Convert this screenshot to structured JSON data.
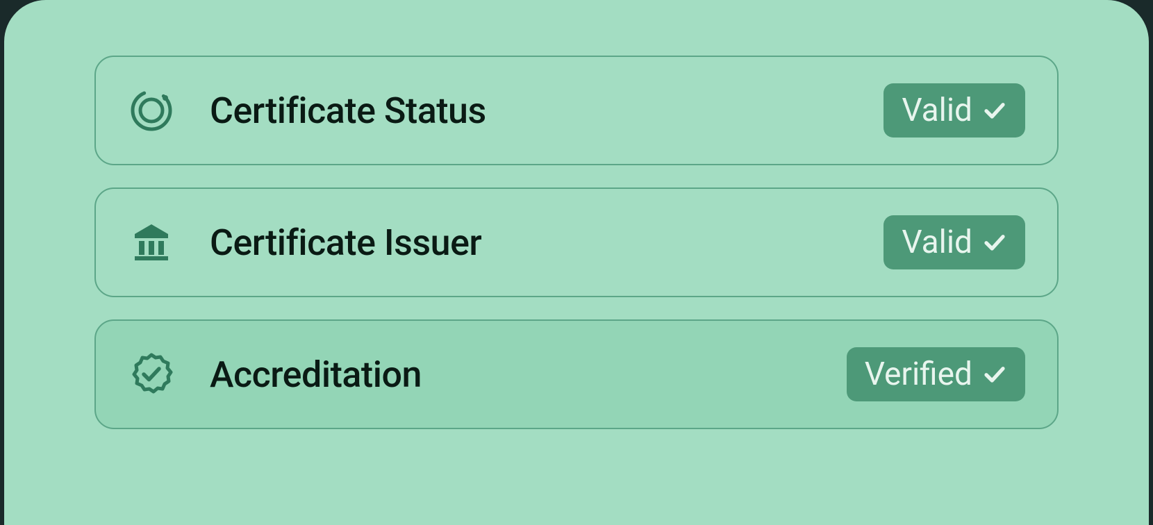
{
  "rows": [
    {
      "icon": "status-circle-icon",
      "label": "Certificate Status",
      "badge": "Valid",
      "highlight": false
    },
    {
      "icon": "institution-icon",
      "label": "Certificate Issuer",
      "badge": "Valid",
      "highlight": false
    },
    {
      "icon": "verified-seal-icon",
      "label": "Accreditation",
      "badge": "Verified",
      "highlight": true
    }
  ],
  "colors": {
    "panel": "#a3ddc2",
    "border": "#5ca688",
    "badge": "#4d9978",
    "highlight": "#93d5b6",
    "text": "#0a1a14",
    "badgeText": "#e8f5ee",
    "iconStroke": "#2f7a5c"
  }
}
